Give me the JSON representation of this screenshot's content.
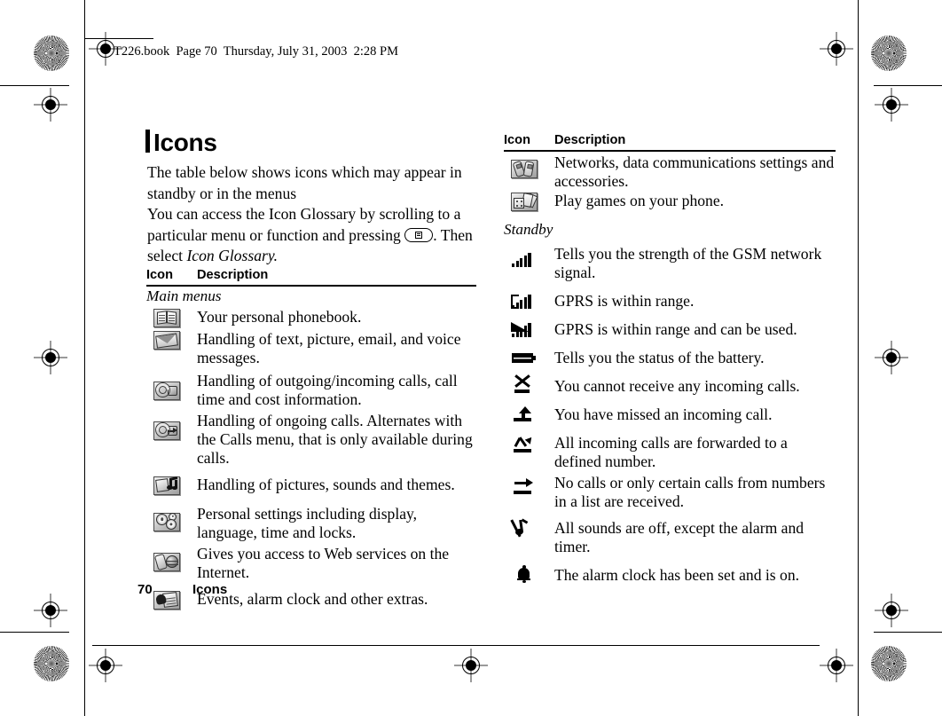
{
  "header": {
    "file_line": "T226.book  Page 70  Thursday, July 31, 2003  2:28 PM"
  },
  "page": {
    "title": "Icons",
    "intro_line1": "The table below shows icons which may appear in standby or in the menus",
    "intro_line2_a": "You can access the Icon Glossary by scrolling to a particular menu or function and pressing ",
    "intro_line2_b": ". Then select ",
    "intro_line2_italic": "Icon Glossary.",
    "key_icon": "menu-key-icon"
  },
  "footer": {
    "page_number": "70",
    "chapter": "Icons"
  },
  "table": {
    "header_icon": "Icon",
    "header_description": "Description"
  },
  "left_column": {
    "section_label": "Main menus",
    "rows": [
      {
        "icon": "phonebook-icon",
        "description": "Your personal phonebook."
      },
      {
        "icon": "messaging-envelope-icon",
        "description": "Handling of text, picture, email, and voice messages."
      },
      {
        "icon": "call-info-icon",
        "description": "Handling of outgoing/incoming calls, call time and cost information."
      },
      {
        "icon": "ongoing-calls-icon",
        "description": "Handling of ongoing calls. Alternates with the Calls menu, that is only available during calls."
      },
      {
        "icon": "pictures-sounds-icon",
        "description": "Handling of pictures, sounds and themes."
      },
      {
        "icon": "settings-gears-icon",
        "description": "Personal settings including display, language, time and locks."
      },
      {
        "icon": "web-services-icon",
        "description": "Gives you access to Web services on the Internet."
      },
      {
        "icon": "extras-alarm-icon",
        "description": "Events, alarm clock and other extras."
      }
    ]
  },
  "right_column": {
    "menu_rows": [
      {
        "icon": "connectivity-icon",
        "description": "Networks, data communications settings and accessories."
      },
      {
        "icon": "games-icon",
        "description": "Play games on your phone."
      }
    ],
    "section_label": "Standby",
    "standby_rows": [
      {
        "icon": "signal-strength-icon",
        "description": "Tells you the strength of the GSM network signal."
      },
      {
        "icon": "gprs-in-range-icon",
        "description": "GPRS is within range."
      },
      {
        "icon": "gprs-usable-icon",
        "description": "GPRS is within range and can be used."
      },
      {
        "icon": "battery-status-icon",
        "description": "Tells you the status of the battery."
      },
      {
        "icon": "no-incoming-calls-icon",
        "description": "You cannot receive any incoming calls."
      },
      {
        "icon": "missed-call-icon",
        "description": "You have missed an incoming call."
      },
      {
        "icon": "call-forwarding-icon",
        "description": "All incoming calls are forwarded to a defined number."
      },
      {
        "icon": "restricted-calls-icon",
        "description": "No calls or only certain calls from numbers in a list are received."
      },
      {
        "icon": "silent-mode-icon",
        "description": "All sounds are off, except the alarm and timer."
      },
      {
        "icon": "alarm-clock-icon",
        "description": "The alarm clock has been set and is on."
      }
    ]
  }
}
